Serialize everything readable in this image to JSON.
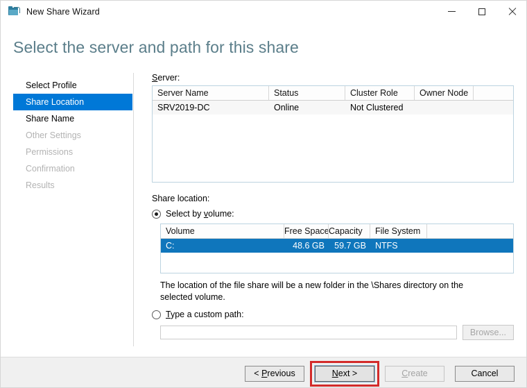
{
  "window": {
    "title": "New Share Wizard",
    "app_icon": "share-folder-icon",
    "minimize_label": "Minimize",
    "maximize_label": "Maximize",
    "close_label": "Close"
  },
  "heading": "Select the server and path for this share",
  "sidebar": {
    "items": [
      {
        "label": "Select Profile",
        "state": "enabled"
      },
      {
        "label": "Share Location",
        "state": "selected"
      },
      {
        "label": "Share Name",
        "state": "enabled"
      },
      {
        "label": "Other Settings",
        "state": "disabled"
      },
      {
        "label": "Permissions",
        "state": "disabled"
      },
      {
        "label": "Confirmation",
        "state": "disabled"
      },
      {
        "label": "Results",
        "state": "disabled"
      }
    ]
  },
  "server_section": {
    "label": "Server:",
    "columns": [
      "Server Name",
      "Status",
      "Cluster Role",
      "Owner Node"
    ],
    "rows": [
      {
        "server_name": "SRV2019-DC",
        "status": "Online",
        "cluster_role": "Not Clustered",
        "owner_node": ""
      }
    ]
  },
  "share_location": {
    "label": "Share location:",
    "option_volume": "Select by volume:",
    "option_volume_selected": true,
    "volume_columns": [
      "Volume",
      "Free Space",
      "Capacity",
      "File System"
    ],
    "volume_rows": [
      {
        "volume": "C:",
        "free_space": "48.6 GB",
        "capacity": "59.7 GB",
        "file_system": "NTFS",
        "selected": true
      }
    ],
    "hint": "The location of the file share will be a new folder in the \\Shares directory on the selected volume.",
    "option_custom": "Type a custom path:",
    "option_custom_selected": false,
    "custom_path_value": "",
    "custom_path_placeholder": "",
    "browse_label": "Browse..."
  },
  "footer": {
    "previous_label": "< Previous",
    "next_label": "Next >",
    "create_label": "Create",
    "cancel_label": "Cancel",
    "next_highlighted": true,
    "create_disabled": true,
    "highlight_color": "#d32b2b"
  },
  "colors": {
    "accent": "#0078d7",
    "selection": "#0f76bc",
    "heading": "#5b7e8a",
    "disabled_text": "#b3b3b3"
  }
}
